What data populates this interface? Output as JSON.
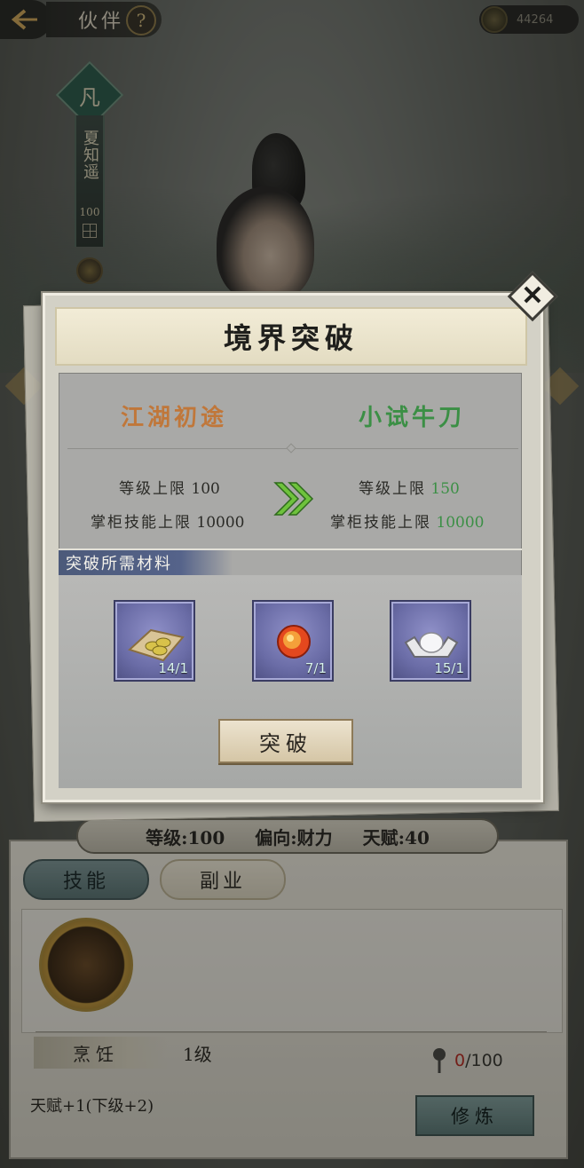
{
  "topbar": {
    "title": "伙伴",
    "help": "?",
    "coins": "44264"
  },
  "character": {
    "rank": "凡",
    "name": "夏知遥",
    "level": "100"
  },
  "dialog": {
    "title": "境界突破",
    "close": "✕",
    "realm_from": "江湖初途",
    "realm_to": "小试牛刀",
    "from_stats": [
      {
        "label": "等级上限",
        "value": "100"
      },
      {
        "label": "掌柜技能上限",
        "value": "10000"
      }
    ],
    "to_stats": [
      {
        "label": "等级上限",
        "value": "150"
      },
      {
        "label": "掌柜技能上限",
        "value": "10000"
      }
    ],
    "materials_label": "突破所需材料",
    "materials": [
      {
        "icon": "dumpling-plate-icon",
        "count": "14/1"
      },
      {
        "icon": "fire-orb-icon",
        "count": "7/1"
      },
      {
        "icon": "silver-ingot-icon",
        "count": "15/1"
      }
    ],
    "break_button": "突破",
    "accent_green": "#3b8f45",
    "accent_orange": "#c0773a"
  },
  "stats_bar": {
    "level": "等级:100",
    "tendency": "偏向:财力",
    "talent": "天赋:40"
  },
  "tabs": [
    {
      "label": "技能"
    },
    {
      "label": "副业"
    }
  ],
  "skill": {
    "name": "烹饪",
    "level": "1级",
    "progress_current": "0",
    "progress_max": "/100",
    "talent_text": "天赋+1(下级+2)",
    "train_button": "修炼"
  }
}
